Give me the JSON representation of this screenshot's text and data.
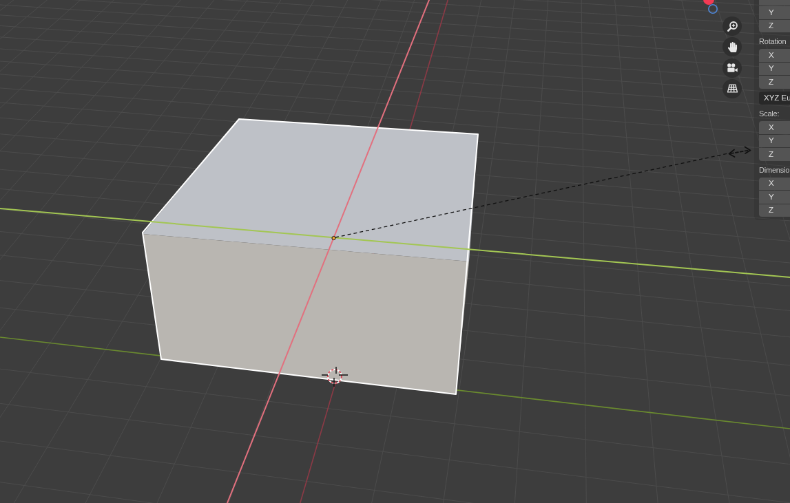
{
  "sidebar": {
    "sections": [
      {
        "partial_field_above": true,
        "fields": [
          "Y",
          "Z"
        ]
      },
      {
        "label": "Rotation",
        "fields": [
          "X",
          "Y",
          "Z"
        ],
        "mode_dropdown": "XYZ Eu"
      },
      {
        "label": "Scale:",
        "fields": [
          "X",
          "Y",
          "Z"
        ]
      },
      {
        "label": "Dimensio",
        "fields": [
          "X",
          "Y",
          "Z"
        ]
      }
    ]
  }
}
